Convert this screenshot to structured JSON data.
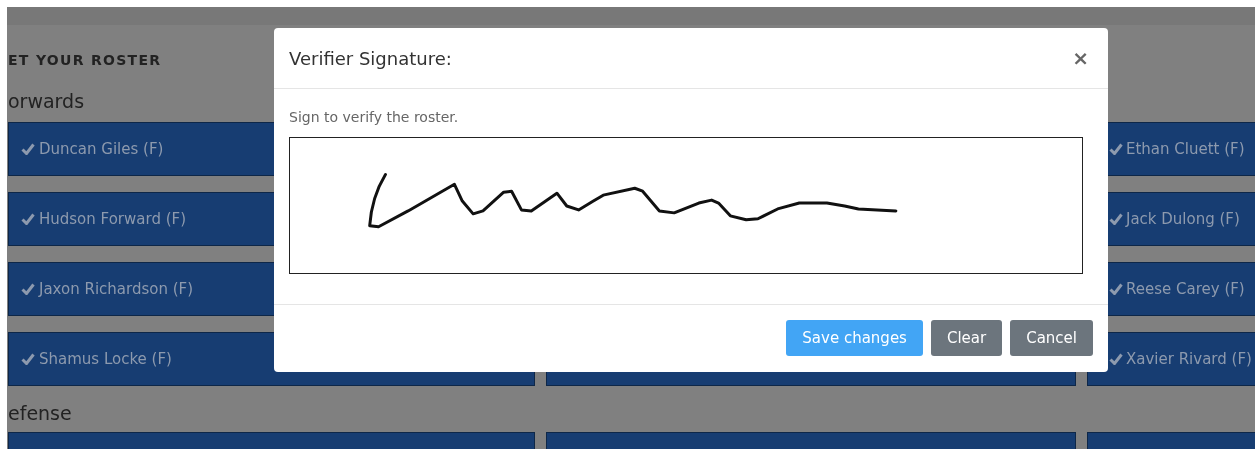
{
  "page": {
    "heading": "ET YOUR ROSTER",
    "sections": [
      {
        "title": "orwards",
        "rows": [
          {
            "players": [
              {
                "name": "Duncan Giles (F)",
                "checked": true
              },
              {
                "name": "Ethan Cluett (F)",
                "checked": true
              }
            ]
          },
          {
            "players": [
              {
                "name": "Hudson Forward (F)",
                "checked": true
              },
              {
                "name": "Jack Dulong (F)",
                "checked": true
              }
            ]
          },
          {
            "players": [
              {
                "name": "Jaxon Richardson (F)",
                "checked": true
              },
              {
                "name": "Reese Carey (F)",
                "checked": true
              }
            ]
          },
          {
            "players": [
              {
                "name": "Shamus Locke (F)",
                "checked": true
              },
              {
                "name": "Xavier Rivard (F)",
                "checked": true
              }
            ]
          }
        ]
      },
      {
        "title": "efense"
      }
    ]
  },
  "modal": {
    "title": "Verifier Signature:",
    "close": "×",
    "instruction": "Sign to verify the roster.",
    "buttons": [
      {
        "label": "Save changes",
        "kind": "primary"
      },
      {
        "label": "Clear",
        "kind": "secondary"
      },
      {
        "label": "Cancel",
        "kind": "secondary"
      }
    ]
  }
}
